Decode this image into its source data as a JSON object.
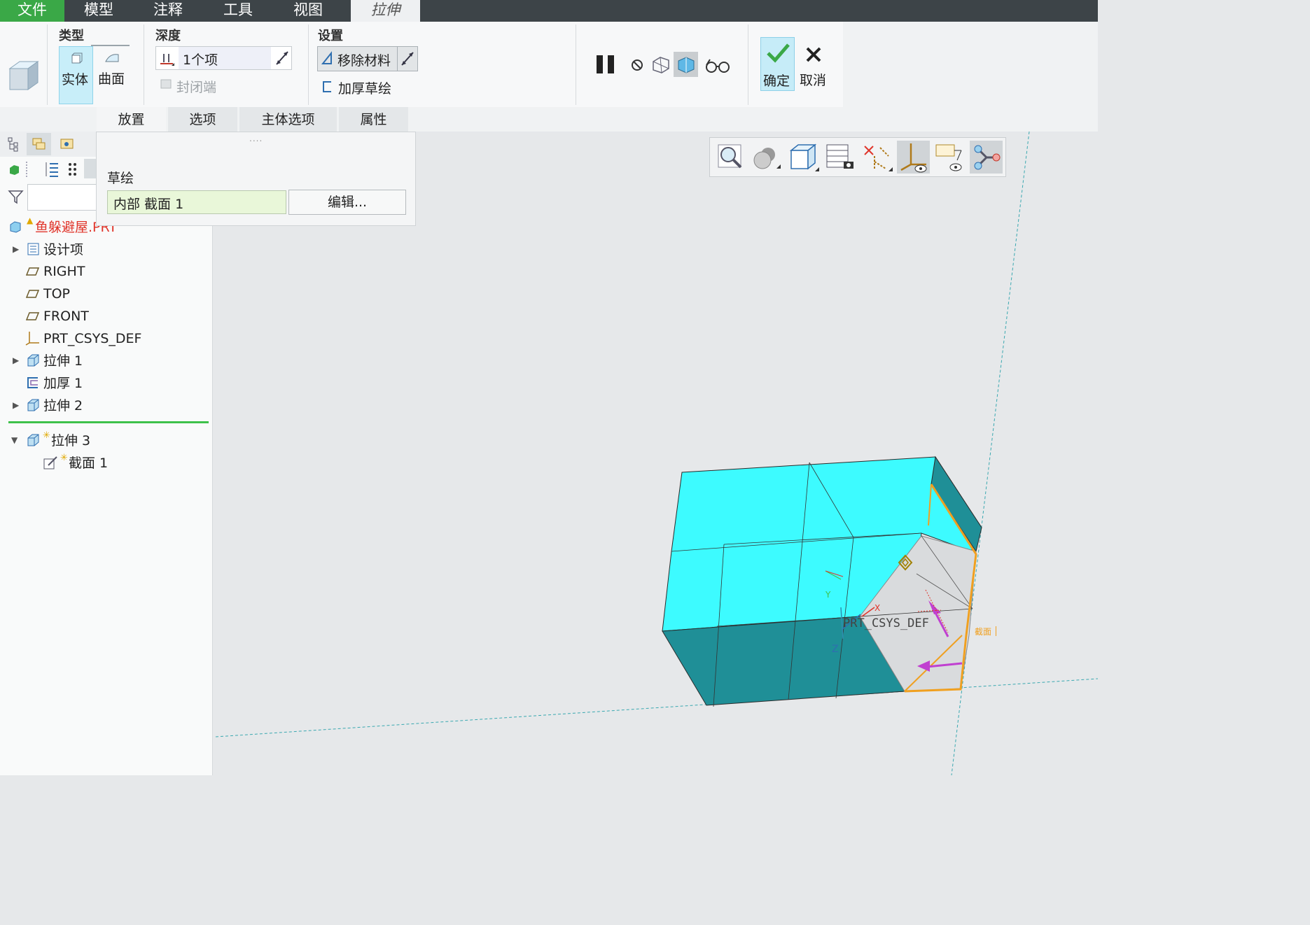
{
  "menubar": {
    "tabs": [
      "文件",
      "模型",
      "注释",
      "工具",
      "视图",
      "拉伸"
    ]
  },
  "ribbon": {
    "type_group": {
      "title": "类型",
      "solid": "实体",
      "surface": "曲面"
    },
    "depth_group": {
      "title": "深度",
      "depth_value": "1个项",
      "closed_ends": "封闭端"
    },
    "settings_group": {
      "title": "设置",
      "remove_material": "移除材料",
      "thicken_sketch": "加厚草绘"
    },
    "confirm": {
      "ok": "确定",
      "cancel": "取消"
    }
  },
  "subtabs": [
    "放置",
    "选项",
    "主体选项",
    "属性"
  ],
  "placement_panel": {
    "grip": "....",
    "sketch_label": "草绘",
    "sketch_value": "内部 截面 1",
    "edit_button": "编辑..."
  },
  "model_tree": {
    "root": "鱼躲避屋.PRT",
    "items": [
      "设计项",
      "RIGHT",
      "TOP",
      "FRONT",
      "PRT_CSYS_DEF",
      "拉伸 1",
      "加厚 1",
      "拉伸 2"
    ],
    "active_feature": "拉伸 3",
    "active_child": "截面 1"
  },
  "viewport_labels": {
    "csys": "PRT_CSYS_DEF",
    "section": "截面",
    "axis_x": "X",
    "axis_y": "Y",
    "axis_z": "Z"
  },
  "colors": {
    "menubar_bg": "#3d4448",
    "file_tab": "#3aa847",
    "model_top": "#3dfbff",
    "model_side": "#1f8f97",
    "section_orange": "#f0a020",
    "direction_arrow": "#c040d0",
    "selected_bg": "#c8eef9"
  }
}
